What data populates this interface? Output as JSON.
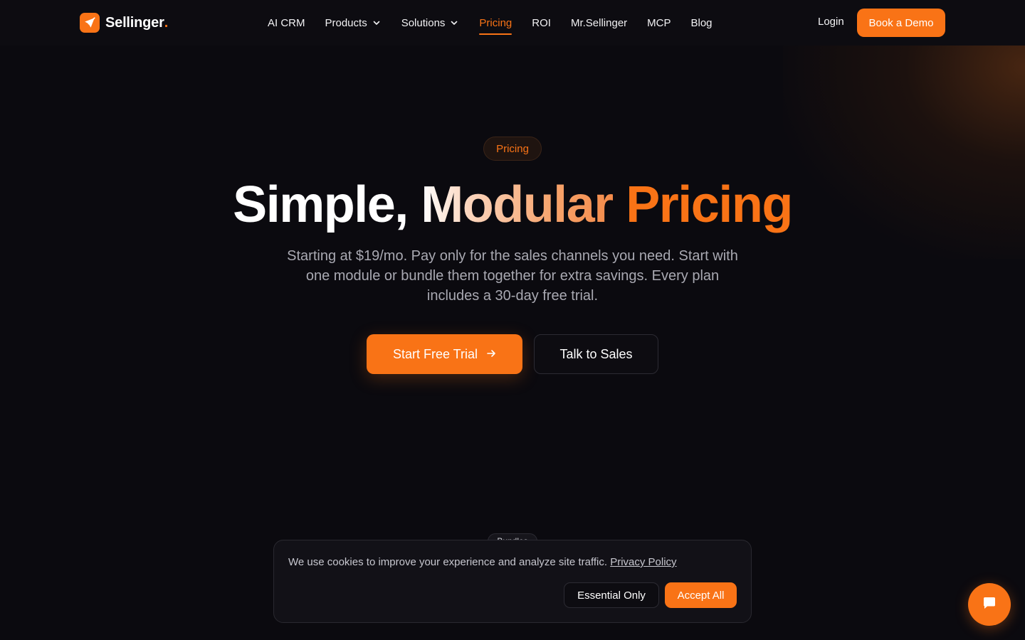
{
  "brand": {
    "name": "Sellinger",
    "dot": ".",
    "accent": "#f97316",
    "icon": "rocket-icon"
  },
  "nav": {
    "items": [
      {
        "label": "AI CRM",
        "dropdown": false,
        "active": false
      },
      {
        "label": "Products",
        "dropdown": true,
        "active": false
      },
      {
        "label": "Solutions",
        "dropdown": true,
        "active": false
      },
      {
        "label": "Pricing",
        "dropdown": false,
        "active": true
      },
      {
        "label": "ROI",
        "dropdown": false,
        "active": false
      },
      {
        "label": "Mr.Sellinger",
        "dropdown": false,
        "active": false
      },
      {
        "label": "MCP",
        "dropdown": false,
        "active": false
      },
      {
        "label": "Blog",
        "dropdown": false,
        "active": false
      }
    ],
    "login_label": "Login",
    "demo_label": "Book a Demo"
  },
  "hero": {
    "badge": "Pricing",
    "title_part1": "Simple, ",
    "title_part2": "Modular",
    "title_part3": " Pricing",
    "subtitle": "Starting at $19/mo. Pay only for the sales channels you need. Start with one module or bundle them together for extra savings. Every plan includes a 30-day free trial.",
    "primary_cta": "Start Free Trial",
    "primary_cta_icon": "arrow-right-icon",
    "secondary_cta": "Talk to Sales"
  },
  "section_pill": "Bundles",
  "cookie": {
    "message": "We use cookies to improve your experience and analyze site traffic.",
    "link_label": "Privacy Policy",
    "essential_label": "Essential Only",
    "accept_label": "Accept All"
  },
  "chat": {
    "icon": "chat-bubble-icon"
  }
}
